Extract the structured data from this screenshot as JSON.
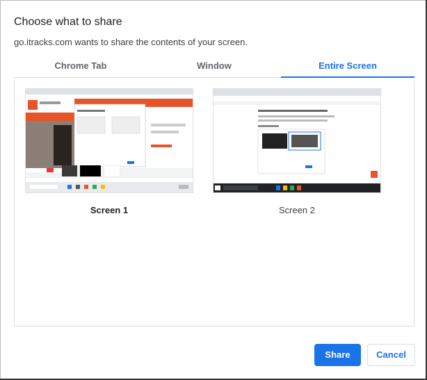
{
  "dialog": {
    "title": "Choose what to share",
    "subtitle": "go.itracks.com wants to share the contents of your screen."
  },
  "tabs": [
    {
      "label": "Chrome Tab",
      "active": false
    },
    {
      "label": "Window",
      "active": false
    },
    {
      "label": "Entire Screen",
      "active": true
    }
  ],
  "sources": [
    {
      "label": "Screen 1",
      "selected": true
    },
    {
      "label": "Screen 2",
      "selected": false
    }
  ],
  "buttons": {
    "share_label": "Share",
    "cancel_label": "Cancel"
  },
  "colors": {
    "accent": "#1a73e8",
    "thumbnail_brand": "#e8542a"
  }
}
